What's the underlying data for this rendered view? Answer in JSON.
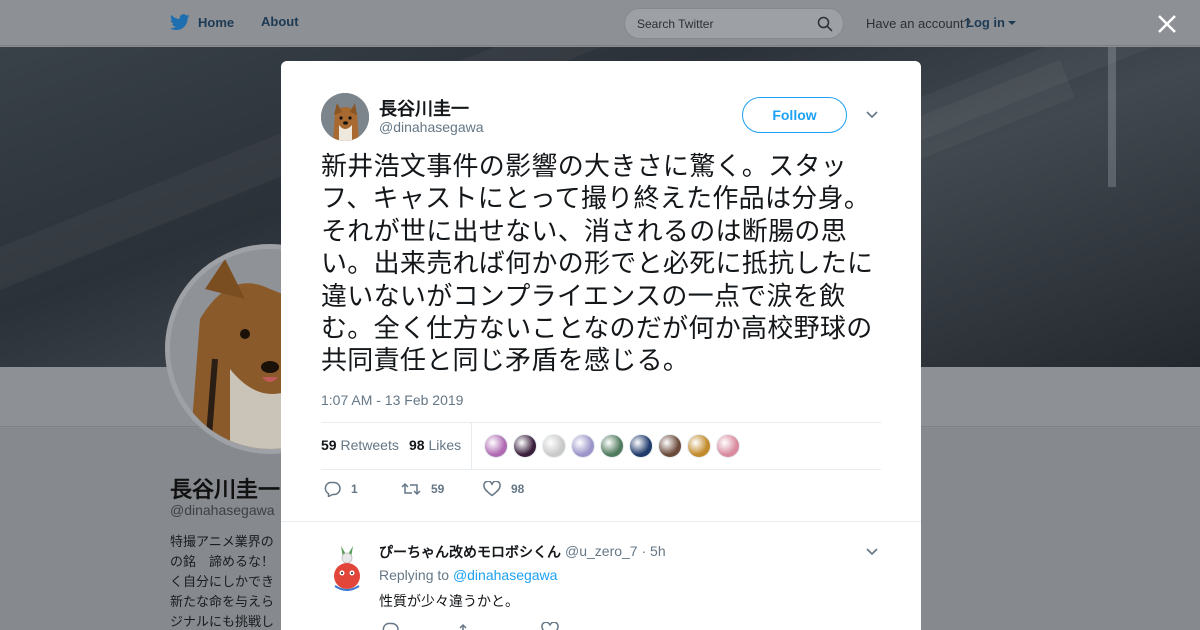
{
  "nav": {
    "home_label": "Home",
    "about_label": "About",
    "search_placeholder": "Search Twitter",
    "account_prompt": "Have an account?",
    "login_label": "Log in"
  },
  "profile_bg": {
    "name": "長谷川圭一",
    "handle": "@dinahasegawa",
    "bio_lines": [
      "特撮アニメ業界の",
      "の銘　諦めるな！",
      "く自分にしかでき",
      "新たな命を与えら",
      "ジナルにも挑戦し"
    ]
  },
  "tweet": {
    "author_name": "長谷川圭一",
    "author_handle": "@dinahasegawa",
    "follow_label": "Follow",
    "text": "新井浩文事件の影響の大きさに驚く。スタッフ、キャストにとって撮り終えた作品は分身。それが世に出せない、消されるのは断腸の思い。出来売れば何かの形でと必死に抵抗したに違いないがコンプライエンスの一点で涙を飲む。全く仕方ないことなのだが何か高校野球の共同責任と同じ矛盾を感じる。",
    "timestamp": "1:07 AM - 13 Feb 2019",
    "retweets_count": "59",
    "retweets_label": "Retweets",
    "likes_count": "98",
    "likes_label": "Likes",
    "liker_colors": [
      "#b06ab3",
      "#3a1f3d",
      "#c9c9c9",
      "#9b95c9",
      "#4f7a5c",
      "#1f3a6b",
      "#6b4a3a",
      "#c28a2a",
      "#d98a9e"
    ],
    "reply_count": "1",
    "retweet_action_count": "59",
    "like_action_count": "98"
  },
  "reply": {
    "name": "ぴーちゃん改めモロボシくん",
    "handle": "@u_zero_7",
    "time": "5h",
    "replying_to_label": "Replying to",
    "replying_to_handle": "@dinahasegawa",
    "text": "性質が少々違うかと。"
  },
  "colors": {
    "accent": "#1da1f2",
    "secondary_text": "#657786",
    "border": "#e6ecf0"
  }
}
